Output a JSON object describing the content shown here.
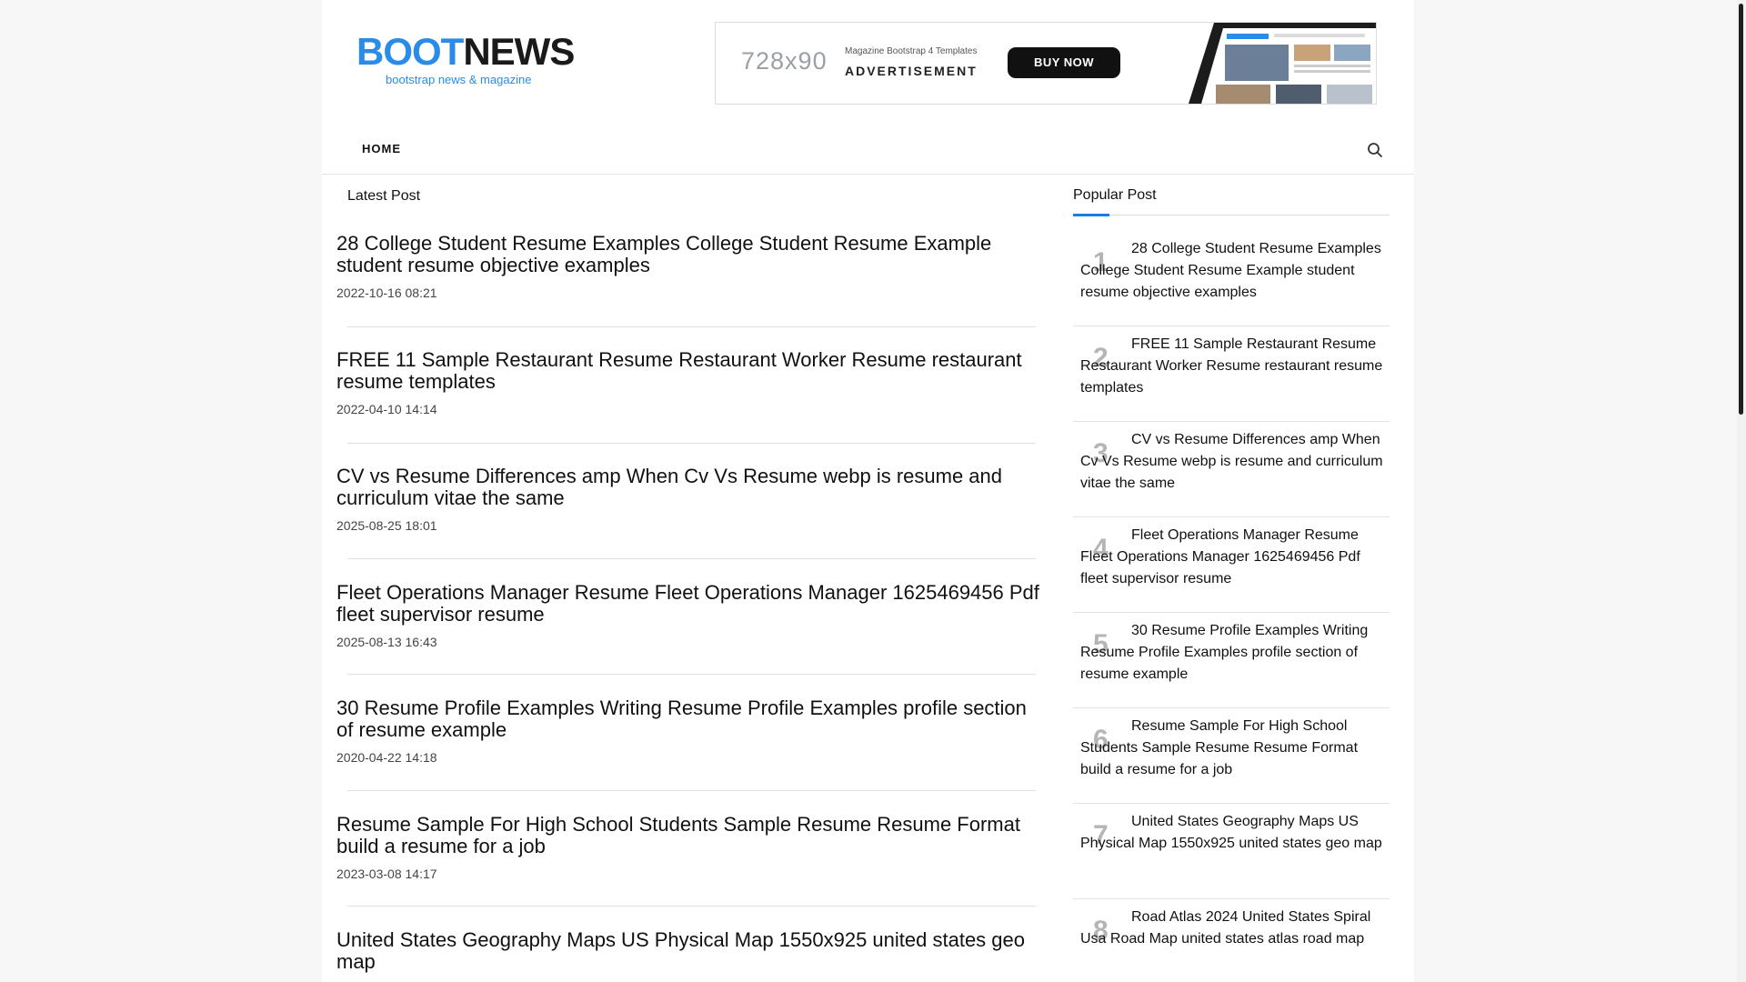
{
  "logo": {
    "part1": "BOOT",
    "part2": "NEWS",
    "tagline": "bootstrap news & magazine"
  },
  "ad": {
    "size": "728x90",
    "small": "Magazine Bootstrap 4 Templates",
    "label": "ADVERTISEMENT",
    "button": "BUY NOW"
  },
  "nav": {
    "home": "HOME",
    "search_icon": "search-icon"
  },
  "latest": {
    "heading": "Latest Post",
    "posts": [
      {
        "title": "28 College Student Resume Examples College Student Resume Example student resume objective examples",
        "date": "2022-10-16 08:21"
      },
      {
        "title": "FREE 11 Sample Restaurant Resume Restaurant Worker Resume restaurant resume templates",
        "date": "2022-04-10 14:14"
      },
      {
        "title": "CV vs Resume Differences amp When Cv Vs Resume webp is resume and curriculum vitae the same",
        "date": "2025-08-25 18:01"
      },
      {
        "title": "Fleet Operations Manager Resume Fleet Operations Manager 1625469456 Pdf fleet supervisor resume",
        "date": "2025-08-13 16:43"
      },
      {
        "title": "30 Resume Profile Examples Writing Resume Profile Examples profile section of resume example",
        "date": "2020-04-22 14:18"
      },
      {
        "title": "Resume Sample For High School Students Sample Resume Resume Format build a resume for a job",
        "date": "2023-03-08 14:17"
      },
      {
        "title": "United States Geography Maps US Physical Map 1550x925 united states geo map",
        "date": ""
      }
    ]
  },
  "popular": {
    "heading": "Popular Post",
    "items": [
      {
        "num": "1",
        "title": "28 College Student Resume Examples College Student Resume Example student resume objective examples"
      },
      {
        "num": "2",
        "title": "FREE 11 Sample Restaurant Resume Restaurant Worker Resume restaurant resume templates"
      },
      {
        "num": "3",
        "title": "CV vs Resume Differences amp When Cv Vs Resume webp is resume and curriculum vitae the same"
      },
      {
        "num": "4",
        "title": "Fleet Operations Manager Resume Fleet Operations Manager 1625469456 Pdf fleet supervisor resume"
      },
      {
        "num": "5",
        "title": "30 Resume Profile Examples Writing Resume Profile Examples profile section of resume example"
      },
      {
        "num": "6",
        "title": "Resume Sample For High School Students Sample Resume Resume Format build a resume for a job"
      },
      {
        "num": "7",
        "title": "United States Geography Maps US Physical Map 1550x925 united states geo map"
      },
      {
        "num": "8",
        "title": "Road Atlas 2024 United States Spiral Usa Road Map united states atlas road map"
      }
    ]
  },
  "colors": {
    "brand": "#2a8ce8",
    "accent": "#1a7de0"
  }
}
